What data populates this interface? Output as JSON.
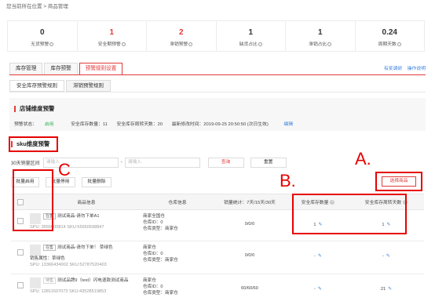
{
  "breadcrumb": "您当前所在位置 > 商品管理",
  "stats": [
    {
      "value": "0",
      "label": "无货预警",
      "red": false
    },
    {
      "value": "1",
      "label": "安全期预警",
      "red": true
    },
    {
      "value": "2",
      "label": "滞销预警",
      "red": true
    },
    {
      "value": "1",
      "label": "缺货占比",
      "red": false
    },
    {
      "value": "1",
      "label": "滞销占比",
      "red": false
    },
    {
      "value": "0.24",
      "label": "周期天数",
      "red": false
    }
  ],
  "tabs": [
    "库存管理",
    "库存预警",
    "预警规则设置"
  ],
  "top_links": [
    "有奖调研",
    "操作说明"
  ],
  "subtabs": [
    "安全库存预警规则",
    "滞销预警规则"
  ],
  "shop_section": {
    "title": "店铺维度预警",
    "status_label": "预警状态：",
    "status_value": "启用",
    "safety_stock": "安全库存数量：11",
    "turnover": "安全库存周转天数：20",
    "modified": "最新修改时间：2019-09-25 20:50:50 (次日生效)",
    "edit": "编辑"
  },
  "sku_section": {
    "title": "sku维度预警"
  },
  "filter": {
    "label": "30天销量区间",
    "from_placeholder": "请输入",
    "dash": "-",
    "to_placeholder": "请输入",
    "search": "查询",
    "reset": "重置"
  },
  "batch": {
    "enable": "批量启用",
    "disable": "批量停用",
    "delete": "批量删除"
  },
  "select_goods": "选择商品",
  "table": {
    "headers": {
      "info": "商品信息",
      "warehouse": "仓库信息",
      "sales": "销量统计：7天/15天/30天",
      "safety": "安全库存数量",
      "turnover": "安全库存周转天数"
    },
    "rows": [
      {
        "tag": "在售",
        "name": "测试商品-请勿下单A1",
        "spu": "SPU: 3555000814",
        "sku": "SKU:55650598847",
        "attr": "",
        "wh1": "商家全国仓",
        "wh2": "仓库ID：0",
        "wh3": "仓库类型：商家仓",
        "sales": "0/0/0",
        "safety": "1",
        "turnover": "1"
      },
      {
        "tag": "在售",
        "name": "测试商品-请勿下单！ 草绿色",
        "spu": "SPU: 13366434002",
        "sku": "SKU:52787520403",
        "attr": "销售属性：草绿色",
        "wh1": "商家仓",
        "wh2": "仓库ID：0",
        "wh3": "仓库类型：商家仓",
        "sales": "0/0/0",
        "safety": "-",
        "turnover": "-"
      },
      {
        "tag": "待售",
        "name": "测试品牌9（test）闪电退款测试商品",
        "spu": "SPU: 12811507073",
        "sku": "SKU:43528519853",
        "attr": "",
        "wh1": "商家仓",
        "wh2": "仓库ID：0",
        "wh3": "仓库类型：商家仓",
        "sales": "60/60/60",
        "safety": "-",
        "turnover": "21"
      }
    ]
  },
  "annotations": {
    "a": "A.",
    "b": "B.",
    "c": "C"
  }
}
